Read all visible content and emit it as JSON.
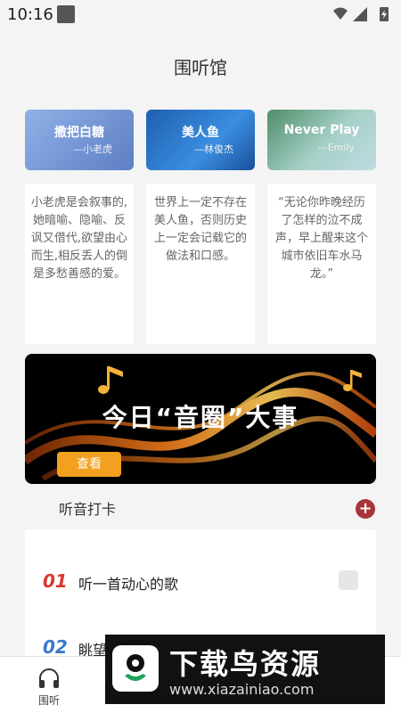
{
  "status": {
    "time": "10:16"
  },
  "header": {
    "title": "围听馆"
  },
  "cards": [
    {
      "title": "撒把白糖",
      "artist": "—小老虎",
      "text": "小老虎是会叙事的,她暗喻、隐喻、反讽又借代,欲望由心而生,相反丢人的倒是多愁善感的爱。",
      "color": "#6f8fcf"
    },
    {
      "title": "美人鱼",
      "artist": "—林俊杰",
      "text": "世界上一定不存在美人鱼，否则历史上一定会记载它的做法和口感。",
      "color": "#2c72c0"
    },
    {
      "title": "Never Play",
      "artist": "—Emily",
      "text": "“无论你昨晚经历了怎样的泣不成声，早上醒来这个城市依旧车水马龙。”",
      "color": "#8fc4bd"
    }
  ],
  "hero": {
    "title": "今日“音圈”大事",
    "button": "查看"
  },
  "checkin": {
    "label": "听音打卡",
    "add_icon": "plus-icon"
  },
  "tasks": [
    {
      "num": "01",
      "text": "听一首动心的歌",
      "color": "#d83a2f"
    },
    {
      "num": "02",
      "text": "眺望",
      "color": "#3b78c9"
    }
  ],
  "tabbar": {
    "items": [
      {
        "label": "围听",
        "icon": "headphones-icon"
      }
    ]
  },
  "watermark": {
    "main": "下载鸟资源",
    "url": "www.xiazainiao.com"
  },
  "colors": {
    "accent_red": "#a9333a",
    "accent_orange": "#f3a021"
  }
}
